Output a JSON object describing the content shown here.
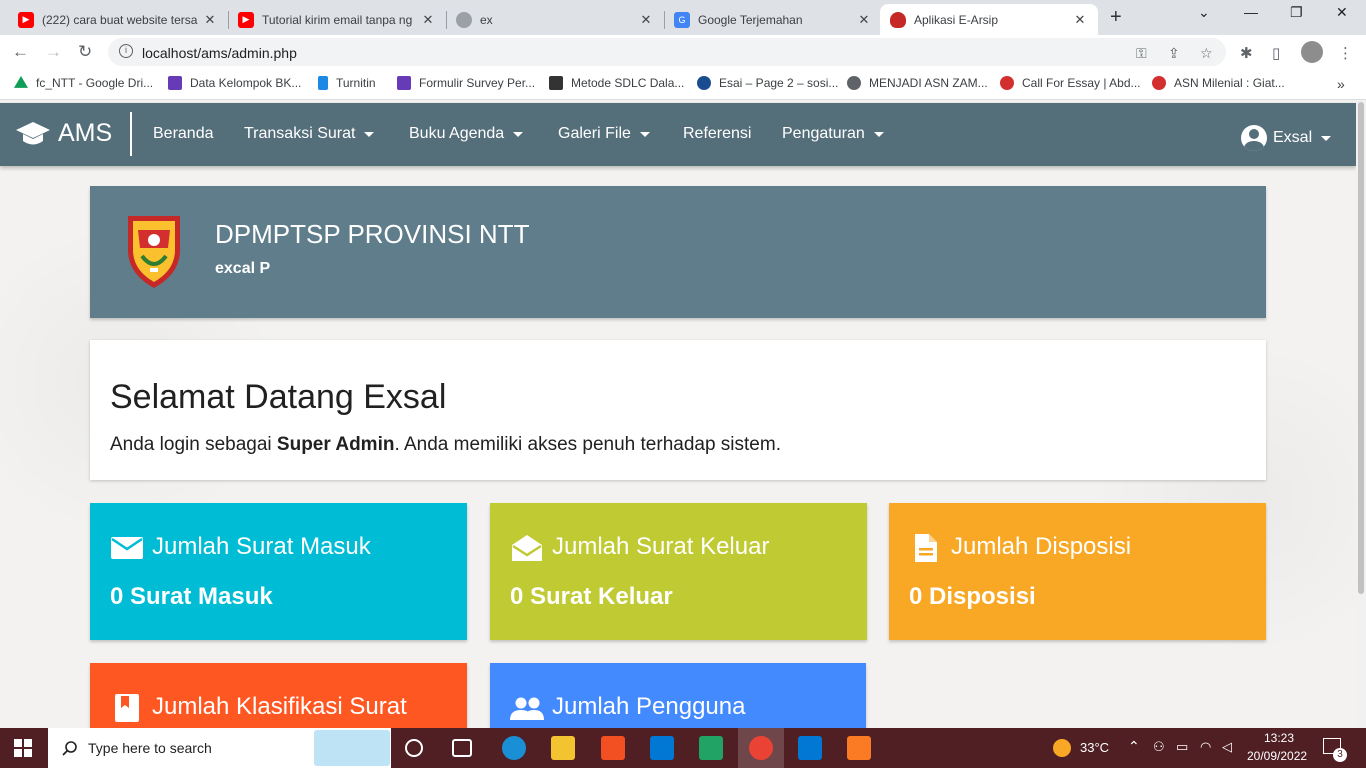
{
  "browser": {
    "tabs": [
      {
        "title": "(222) cara buat website tersa",
        "icon": "youtube-icon",
        "color": "#ff0000"
      },
      {
        "title": "Tutorial kirim email tanpa ng",
        "icon": "youtube-icon",
        "color": "#ff0000"
      },
      {
        "title": "ex",
        "icon": "avatar-icon",
        "color": "#9aa0a6"
      },
      {
        "title": "Google Terjemahan",
        "icon": "translate-icon",
        "color": "#4285f4"
      },
      {
        "title": "Aplikasi E-Arsip",
        "icon": "logo-icon",
        "color": "#c62828"
      }
    ],
    "url": "localhost/ams/admin.php",
    "bookmarks": [
      {
        "label": "fc_NTT - Google Dri...",
        "icon": "google-drive-icon",
        "color": "#0f9d58"
      },
      {
        "label": "Data Kelompok BK...",
        "icon": "form-icon",
        "color": "#673ab7"
      },
      {
        "label": "Turnitin",
        "icon": "turnitin-icon",
        "color": "#1e88e5"
      },
      {
        "label": "Formulir Survey Per...",
        "icon": "form-icon",
        "color": "#673ab7"
      },
      {
        "label": "Metode SDLC Dala...",
        "icon": "g-icon",
        "color": "#333333"
      },
      {
        "label": "Esai – Page 2 – sosi...",
        "icon": "site-icon",
        "color": "#1a4d8f"
      },
      {
        "label": "MENJADI ASN ZAM...",
        "icon": "globe-icon",
        "color": "#5f6368"
      },
      {
        "label": "Call For Essay | Abd...",
        "icon": "site-icon",
        "color": "#d32f2f"
      },
      {
        "label": "ASN Milenial : Giat...",
        "icon": "site-icon",
        "color": "#d32f2f"
      }
    ],
    "more": "»"
  },
  "nav": {
    "brand": "AMS",
    "items": [
      {
        "label": "Beranda",
        "dropdown": false
      },
      {
        "label": "Transaksi Surat",
        "dropdown": true
      },
      {
        "label": "Buku Agenda",
        "dropdown": true
      },
      {
        "label": "Galeri File",
        "dropdown": true
      },
      {
        "label": "Referensi",
        "dropdown": false
      },
      {
        "label": "Pengaturan",
        "dropdown": true
      }
    ],
    "user": "Exsal"
  },
  "header": {
    "institution": "DPMPTSP PROVINSI NTT",
    "user": "excal P"
  },
  "welcome": {
    "title": "Selamat Datang Exsal",
    "text_before": "Anda login sebagai ",
    "role": "Super Admin",
    "text_after": ". Anda memiliki akses penuh terhadap sistem."
  },
  "stats": [
    {
      "title": "Jumlah Surat Masuk",
      "value": "0 Surat Masuk",
      "color": "#00bcd4",
      "icon": "mail-icon"
    },
    {
      "title": "Jumlah Surat Keluar",
      "value": "0 Surat Keluar",
      "color": "#c0ca33",
      "icon": "drafts-icon"
    },
    {
      "title": "Jumlah Disposisi",
      "value": "0 Disposisi",
      "color": "#f9a825",
      "icon": "description-icon"
    },
    {
      "title": "Jumlah Klasifikasi Surat",
      "value": "",
      "color": "#ff5722",
      "icon": "bookmark-icon"
    },
    {
      "title": "Jumlah Pengguna",
      "value": "",
      "color": "#448aff",
      "icon": "people-icon"
    }
  ],
  "taskbar": {
    "search_placeholder": "Type here to search",
    "weather": "33°C",
    "time": "13:23",
    "date": "20/09/2022",
    "notifications": "3"
  }
}
